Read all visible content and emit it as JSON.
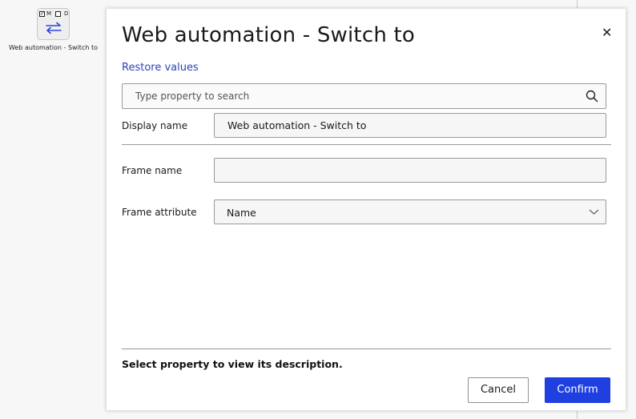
{
  "canvas": {
    "node": {
      "label": "Web automation - Switch to",
      "flag_m": "M",
      "flag_d": "D",
      "icon": "swap-arrows-icon"
    }
  },
  "dialog": {
    "title": "Web automation - Switch to",
    "close_icon": "close-icon",
    "restore_label": "Restore values",
    "search": {
      "placeholder": "Type property to search",
      "value": "",
      "icon": "search-icon"
    },
    "properties": {
      "display_name": {
        "label": "Display name",
        "value": "Web automation - Switch to"
      },
      "frame_name": {
        "label": "Frame name",
        "value": ""
      },
      "frame_attribute": {
        "label": "Frame attribute",
        "value": "Name",
        "icon": "chevron-down-icon"
      }
    },
    "description": "Select property to view its description.",
    "buttons": {
      "cancel": "Cancel",
      "confirm": "Confirm"
    }
  },
  "colors": {
    "accent": "#1f3fe0",
    "link": "#2a45b8",
    "background": "#f7f7f7"
  }
}
